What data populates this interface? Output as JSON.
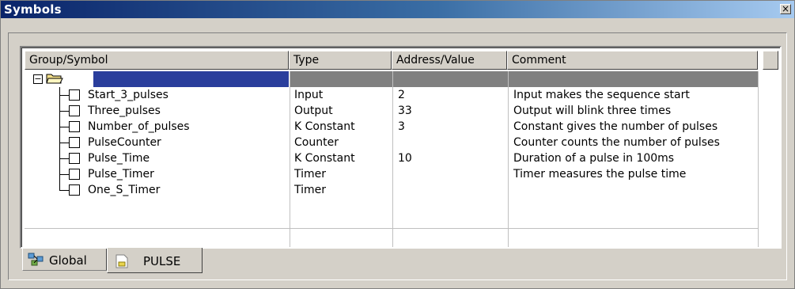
{
  "window": {
    "title": "Symbols",
    "close_label": "×"
  },
  "table": {
    "headers": [
      "Group/Symbol",
      "Type",
      "Address/Value",
      "Comment"
    ],
    "group": {
      "name": "",
      "type": "",
      "address": "",
      "comment": ""
    },
    "rows": [
      {
        "symbol": "Start_3_pulses",
        "type": "Input",
        "address": "2",
        "comment": "Input makes the sequence start"
      },
      {
        "symbol": "Three_pulses",
        "type": "Output",
        "address": "33",
        "comment": "Output will blink three times"
      },
      {
        "symbol": "Number_of_pulses",
        "type": "K Constant",
        "address": "3",
        "comment": "Constant gives the number of pulses"
      },
      {
        "symbol": "PulseCounter",
        "type": "Counter",
        "address": "",
        "comment": "Counter counts the number of pulses"
      },
      {
        "symbol": "Pulse_Time",
        "type": "K Constant",
        "address": "10",
        "comment": "Duration of a pulse in 100ms"
      },
      {
        "symbol": "Pulse_Timer",
        "type": "Timer",
        "address": "",
        "comment": "Timer measures the pulse time"
      },
      {
        "symbol": "One_S_Timer",
        "type": "Timer",
        "address": "",
        "comment": ""
      }
    ]
  },
  "tabs": [
    {
      "label": "Global",
      "icon": "global-symbols-icon",
      "active": false
    },
    {
      "label": "PULSE",
      "icon": "pulse-program-icon",
      "active": true
    }
  ],
  "colors": {
    "titlebar_start": "#0a246a",
    "titlebar_end": "#a6caf0",
    "selection": "#2a3e9c",
    "group_row": "#808080"
  }
}
